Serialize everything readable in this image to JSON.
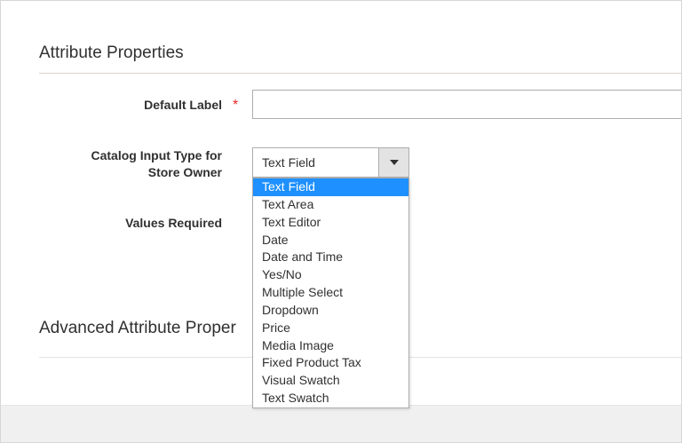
{
  "sections": {
    "attribute_properties": "Attribute Properties",
    "advanced_attribute_properties": "Advanced Attribute Proper"
  },
  "fields": {
    "default_label": {
      "label": "Default Label",
      "required_mark": "*",
      "value": ""
    },
    "catalog_input_type": {
      "label_line1": "Catalog Input Type for",
      "label_line2": "Store Owner",
      "selected": "Text Field"
    },
    "values_required": {
      "label": "Values Required"
    }
  },
  "dropdown": {
    "options": [
      "Text Field",
      "Text Area",
      "Text Editor",
      "Date",
      "Date and Time",
      "Yes/No",
      "Multiple Select",
      "Dropdown",
      "Price",
      "Media Image",
      "Fixed Product Tax",
      "Visual Swatch",
      "Text Swatch"
    ],
    "highlighted_index": 0
  },
  "icons": {
    "dropdown_arrow": "chevron-down-icon"
  },
  "colors": {
    "required_star": "#e22626",
    "highlight": "#1e90ff"
  }
}
